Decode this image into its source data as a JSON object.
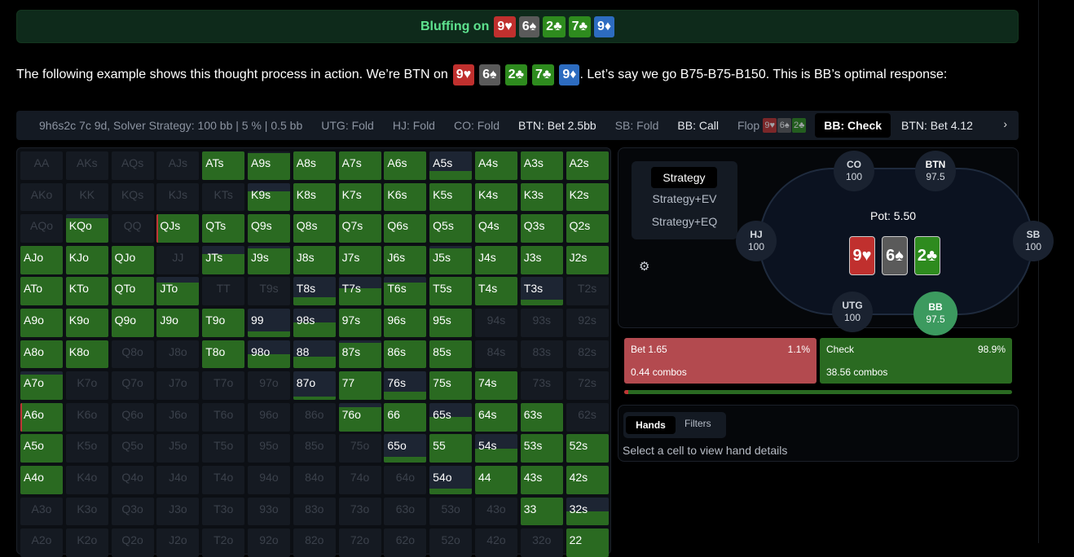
{
  "banner": {
    "text": "Bluffing on",
    "cards": [
      {
        "label": "9♥",
        "color": "#c0302e"
      },
      {
        "label": "6♠",
        "color": "#5a5a5a"
      },
      {
        "label": "2♣",
        "color": "#2e8b1e"
      },
      {
        "label": "7♣",
        "color": "#2e8b1e"
      },
      {
        "label": "9♦",
        "color": "#2d6cc0"
      }
    ]
  },
  "intro": {
    "before": "The following example shows this thought process in action. We’re BTN on",
    "after": ". Let’s say we go B75-B75-B150. This is BB’s optimal response:"
  },
  "actionbar": {
    "items": [
      {
        "label": "9h6s2c 7c 9d, Solver Strategy: 100 bb | 5 % | 0.5 bb",
        "hi": false
      },
      {
        "label": "UTG: Fold",
        "hi": false
      },
      {
        "label": "HJ: Fold",
        "hi": false
      },
      {
        "label": "CO: Fold",
        "hi": false
      },
      {
        "label": "BTN: Bet 2.5bb",
        "hi": true
      },
      {
        "label": "SB: Fold",
        "hi": false
      },
      {
        "label": "BB: Call",
        "hi": true
      }
    ],
    "flop_label": "Flop",
    "flop_cards": [
      {
        "label": "9♥",
        "color": "#c0302e"
      },
      {
        "label": "6♠",
        "color": "#5a5a5a"
      },
      {
        "label": "2♣",
        "color": "#2e8b1e"
      }
    ],
    "active": "BB: Check",
    "next": "BTN: Bet 4.12"
  },
  "grid": [
    [
      "AA",
      0,
      0,
      "off"
    ],
    [
      "AKs",
      0,
      0,
      "off"
    ],
    [
      "AQs",
      0,
      0,
      "off"
    ],
    [
      "AJs",
      0,
      0,
      "off"
    ],
    [
      "ATs",
      1,
      0
    ],
    [
      "A9s",
      0.95,
      0
    ],
    [
      "A8s",
      1,
      0
    ],
    [
      "A7s",
      1,
      0
    ],
    [
      "A6s",
      1,
      0
    ],
    [
      "A5s",
      0.3,
      0
    ],
    [
      "A4s",
      1,
      0
    ],
    [
      "A3s",
      1,
      0
    ],
    [
      "A2s",
      1,
      0
    ],
    [
      "AKo",
      0,
      0,
      "off"
    ],
    [
      "KK",
      0,
      0,
      "off"
    ],
    [
      "KQs",
      0,
      0,
      "off"
    ],
    [
      "KJs",
      0,
      0,
      "off"
    ],
    [
      "KTs",
      0,
      0,
      "off"
    ],
    [
      "K9s",
      0.7,
      0
    ],
    [
      "K8s",
      1,
      0
    ],
    [
      "K7s",
      1,
      0
    ],
    [
      "K6s",
      1,
      0
    ],
    [
      "K5s",
      1,
      0
    ],
    [
      "K4s",
      1,
      0
    ],
    [
      "K3s",
      1,
      0
    ],
    [
      "K2s",
      1,
      0
    ],
    [
      "AQo",
      0,
      0,
      "off"
    ],
    [
      "KQo",
      0.85,
      0
    ],
    [
      "QQ",
      0,
      0,
      "off"
    ],
    [
      "QJs",
      1,
      0.1
    ],
    [
      "QTs",
      1,
      0
    ],
    [
      "Q9s",
      1,
      0
    ],
    [
      "Q8s",
      1,
      0
    ],
    [
      "Q7s",
      1,
      0
    ],
    [
      "Q6s",
      1,
      0
    ],
    [
      "Q5s",
      1,
      0
    ],
    [
      "Q4s",
      1,
      0
    ],
    [
      "Q3s",
      1,
      0
    ],
    [
      "Q2s",
      1,
      0
    ],
    [
      "AJo",
      1,
      0
    ],
    [
      "KJo",
      1,
      0
    ],
    [
      "QJo",
      1,
      0
    ],
    [
      "JJ",
      0,
      0,
      "off"
    ],
    [
      "JTs",
      0.7,
      0
    ],
    [
      "J9s",
      0.9,
      0
    ],
    [
      "J8s",
      1,
      0
    ],
    [
      "J7s",
      1,
      0
    ],
    [
      "J6s",
      1,
      0
    ],
    [
      "J5s",
      0.9,
      0
    ],
    [
      "J4s",
      1,
      0
    ],
    [
      "J3s",
      1,
      0
    ],
    [
      "J2s",
      1,
      0
    ],
    [
      "ATo",
      1,
      0
    ],
    [
      "KTo",
      1,
      0
    ],
    [
      "QTo",
      1,
      0
    ],
    [
      "JTo",
      0.8,
      0
    ],
    [
      "TT",
      0,
      0,
      "off"
    ],
    [
      "T9s",
      0,
      0,
      "off"
    ],
    [
      "T8s",
      0.3,
      0
    ],
    [
      "T7s",
      0.6,
      0
    ],
    [
      "T6s",
      0.8,
      0
    ],
    [
      "T5s",
      1,
      0
    ],
    [
      "T4s",
      1,
      0
    ],
    [
      "T3s",
      0.2,
      0
    ],
    [
      "T2s",
      0,
      0,
      "off"
    ],
    [
      "A9o",
      1,
      0
    ],
    [
      "K9o",
      1,
      0
    ],
    [
      "Q9o",
      1,
      0
    ],
    [
      "J9o",
      1,
      0
    ],
    [
      "T9o",
      1,
      0
    ],
    [
      "99",
      0.2,
      0
    ],
    [
      "98s",
      0.5,
      0
    ],
    [
      "97s",
      1,
      0
    ],
    [
      "96s",
      1,
      0
    ],
    [
      "95s",
      1,
      0
    ],
    [
      "94s",
      0,
      0,
      "off"
    ],
    [
      "93s",
      0,
      0,
      "off"
    ],
    [
      "92s",
      0,
      0,
      "off"
    ],
    [
      "A8o",
      1,
      0
    ],
    [
      "K8o",
      1,
      0
    ],
    [
      "Q8o",
      0,
      0,
      "off"
    ],
    [
      "J8o",
      0,
      0,
      "off"
    ],
    [
      "T8o",
      1,
      0
    ],
    [
      "98o",
      0.5,
      0
    ],
    [
      "88",
      0.4,
      0
    ],
    [
      "87s",
      0.9,
      0
    ],
    [
      "86s",
      1,
      0
    ],
    [
      "85s",
      1,
      0
    ],
    [
      "84s",
      0,
      0,
      "off"
    ],
    [
      "83s",
      0,
      0,
      "off"
    ],
    [
      "82s",
      0,
      0,
      "off"
    ],
    [
      "A7o",
      0.9,
      0
    ],
    [
      "K7o",
      0,
      0,
      "off"
    ],
    [
      "Q7o",
      0,
      0,
      "off"
    ],
    [
      "J7o",
      0,
      0,
      "off"
    ],
    [
      "T7o",
      0,
      0,
      "off"
    ],
    [
      "97o",
      0,
      0,
      "off"
    ],
    [
      "87o",
      0.1,
      0
    ],
    [
      "77",
      1,
      0
    ],
    [
      "76s",
      0.3,
      0
    ],
    [
      "75s",
      1,
      0
    ],
    [
      "74s",
      1,
      0
    ],
    [
      "73s",
      0,
      0,
      "off"
    ],
    [
      "72s",
      0,
      0,
      "off"
    ],
    [
      "A6o",
      1,
      0.1
    ],
    [
      "K6o",
      0,
      0,
      "off"
    ],
    [
      "Q6o",
      0,
      0,
      "off"
    ],
    [
      "J6o",
      0,
      0,
      "off"
    ],
    [
      "T6o",
      0,
      0,
      "off"
    ],
    [
      "96o",
      0,
      0,
      "off"
    ],
    [
      "86o",
      0,
      0,
      "off"
    ],
    [
      "76o",
      0.85,
      0
    ],
    [
      "66",
      1,
      0
    ],
    [
      "65s",
      0.5,
      0
    ],
    [
      "64s",
      1,
      0
    ],
    [
      "63s",
      1,
      0
    ],
    [
      "62s",
      0,
      0,
      "off"
    ],
    [
      "A5o",
      1,
      0
    ],
    [
      "K5o",
      0,
      0,
      "off"
    ],
    [
      "Q5o",
      0,
      0,
      "off"
    ],
    [
      "J5o",
      0,
      0,
      "off"
    ],
    [
      "T5o",
      0,
      0,
      "off"
    ],
    [
      "95o",
      0,
      0,
      "off"
    ],
    [
      "85o",
      0,
      0,
      "off"
    ],
    [
      "75o",
      0,
      0,
      "off"
    ],
    [
      "65o",
      0.2,
      0
    ],
    [
      "55",
      1,
      0
    ],
    [
      "54s",
      0.5,
      0
    ],
    [
      "53s",
      1,
      0
    ],
    [
      "52s",
      1,
      0
    ],
    [
      "A4o",
      1,
      0
    ],
    [
      "K4o",
      0,
      0,
      "off"
    ],
    [
      "Q4o",
      0,
      0,
      "off"
    ],
    [
      "J4o",
      0,
      0,
      "off"
    ],
    [
      "T4o",
      0,
      0,
      "off"
    ],
    [
      "94o",
      0,
      0,
      "off"
    ],
    [
      "84o",
      0,
      0,
      "off"
    ],
    [
      "74o",
      0,
      0,
      "off"
    ],
    [
      "64o",
      0,
      0,
      "off"
    ],
    [
      "54o",
      0.2,
      0
    ],
    [
      "44",
      1,
      0
    ],
    [
      "43s",
      1,
      0
    ],
    [
      "42s",
      1,
      0
    ],
    [
      "A3o",
      0,
      0,
      "off"
    ],
    [
      "K3o",
      0,
      0,
      "off"
    ],
    [
      "Q3o",
      0,
      0,
      "off"
    ],
    [
      "J3o",
      0,
      0,
      "off"
    ],
    [
      "T3o",
      0,
      0,
      "off"
    ],
    [
      "93o",
      0,
      0,
      "off"
    ],
    [
      "83o",
      0,
      0,
      "off"
    ],
    [
      "73o",
      0,
      0,
      "off"
    ],
    [
      "63o",
      0,
      0,
      "off"
    ],
    [
      "53o",
      0,
      0,
      "off"
    ],
    [
      "43o",
      0,
      0,
      "off"
    ],
    [
      "33",
      1,
      0
    ],
    [
      "32s",
      0.5,
      0
    ],
    [
      "A2o",
      0,
      0,
      "off"
    ],
    [
      "K2o",
      0,
      0,
      "off"
    ],
    [
      "Q2o",
      0,
      0,
      "off"
    ],
    [
      "J2o",
      0,
      0,
      "off"
    ],
    [
      "T2o",
      0,
      0,
      "off"
    ],
    [
      "92o",
      0,
      0,
      "off"
    ],
    [
      "82o",
      0,
      0,
      "off"
    ],
    [
      "72o",
      0,
      0,
      "off"
    ],
    [
      "62o",
      0,
      0,
      "off"
    ],
    [
      "52o",
      0,
      0,
      "off"
    ],
    [
      "42o",
      0,
      0,
      "off"
    ],
    [
      "32o",
      0,
      0,
      "off"
    ],
    [
      "22",
      1,
      0
    ]
  ],
  "panel": {
    "tabs": [
      "Strategy",
      "Strategy+EV",
      "Strategy+EQ"
    ],
    "pot": "Pot: 5.50",
    "board": [
      {
        "label": "9♥",
        "color": "#c0302e"
      },
      {
        "label": "6♠",
        "color": "#5a5a5a"
      },
      {
        "label": "2♣",
        "color": "#2e8b1e"
      }
    ],
    "seats": {
      "co": {
        "name": "CO",
        "stack": "100"
      },
      "btn": {
        "name": "BTN",
        "stack": "97.5"
      },
      "hj": {
        "name": "HJ",
        "stack": "100"
      },
      "sb": {
        "name": "SB",
        "stack": "100"
      },
      "utg": {
        "name": "UTG",
        "stack": "100"
      },
      "bb": {
        "name": "BB",
        "stack": "97.5"
      }
    }
  },
  "actions": {
    "bet": {
      "name": "Bet 1.65",
      "pct": "1.1%",
      "combos": "0.44 combos",
      "color": "#b34a4f",
      "freq": 0.011
    },
    "check": {
      "name": "Check",
      "pct": "98.9%",
      "combos": "38.56 combos",
      "color": "#2a6a21",
      "freq": 0.989
    }
  },
  "hands": {
    "tabs": [
      "Hands",
      "Filters"
    ],
    "hint": "Select a cell to view hand details"
  }
}
